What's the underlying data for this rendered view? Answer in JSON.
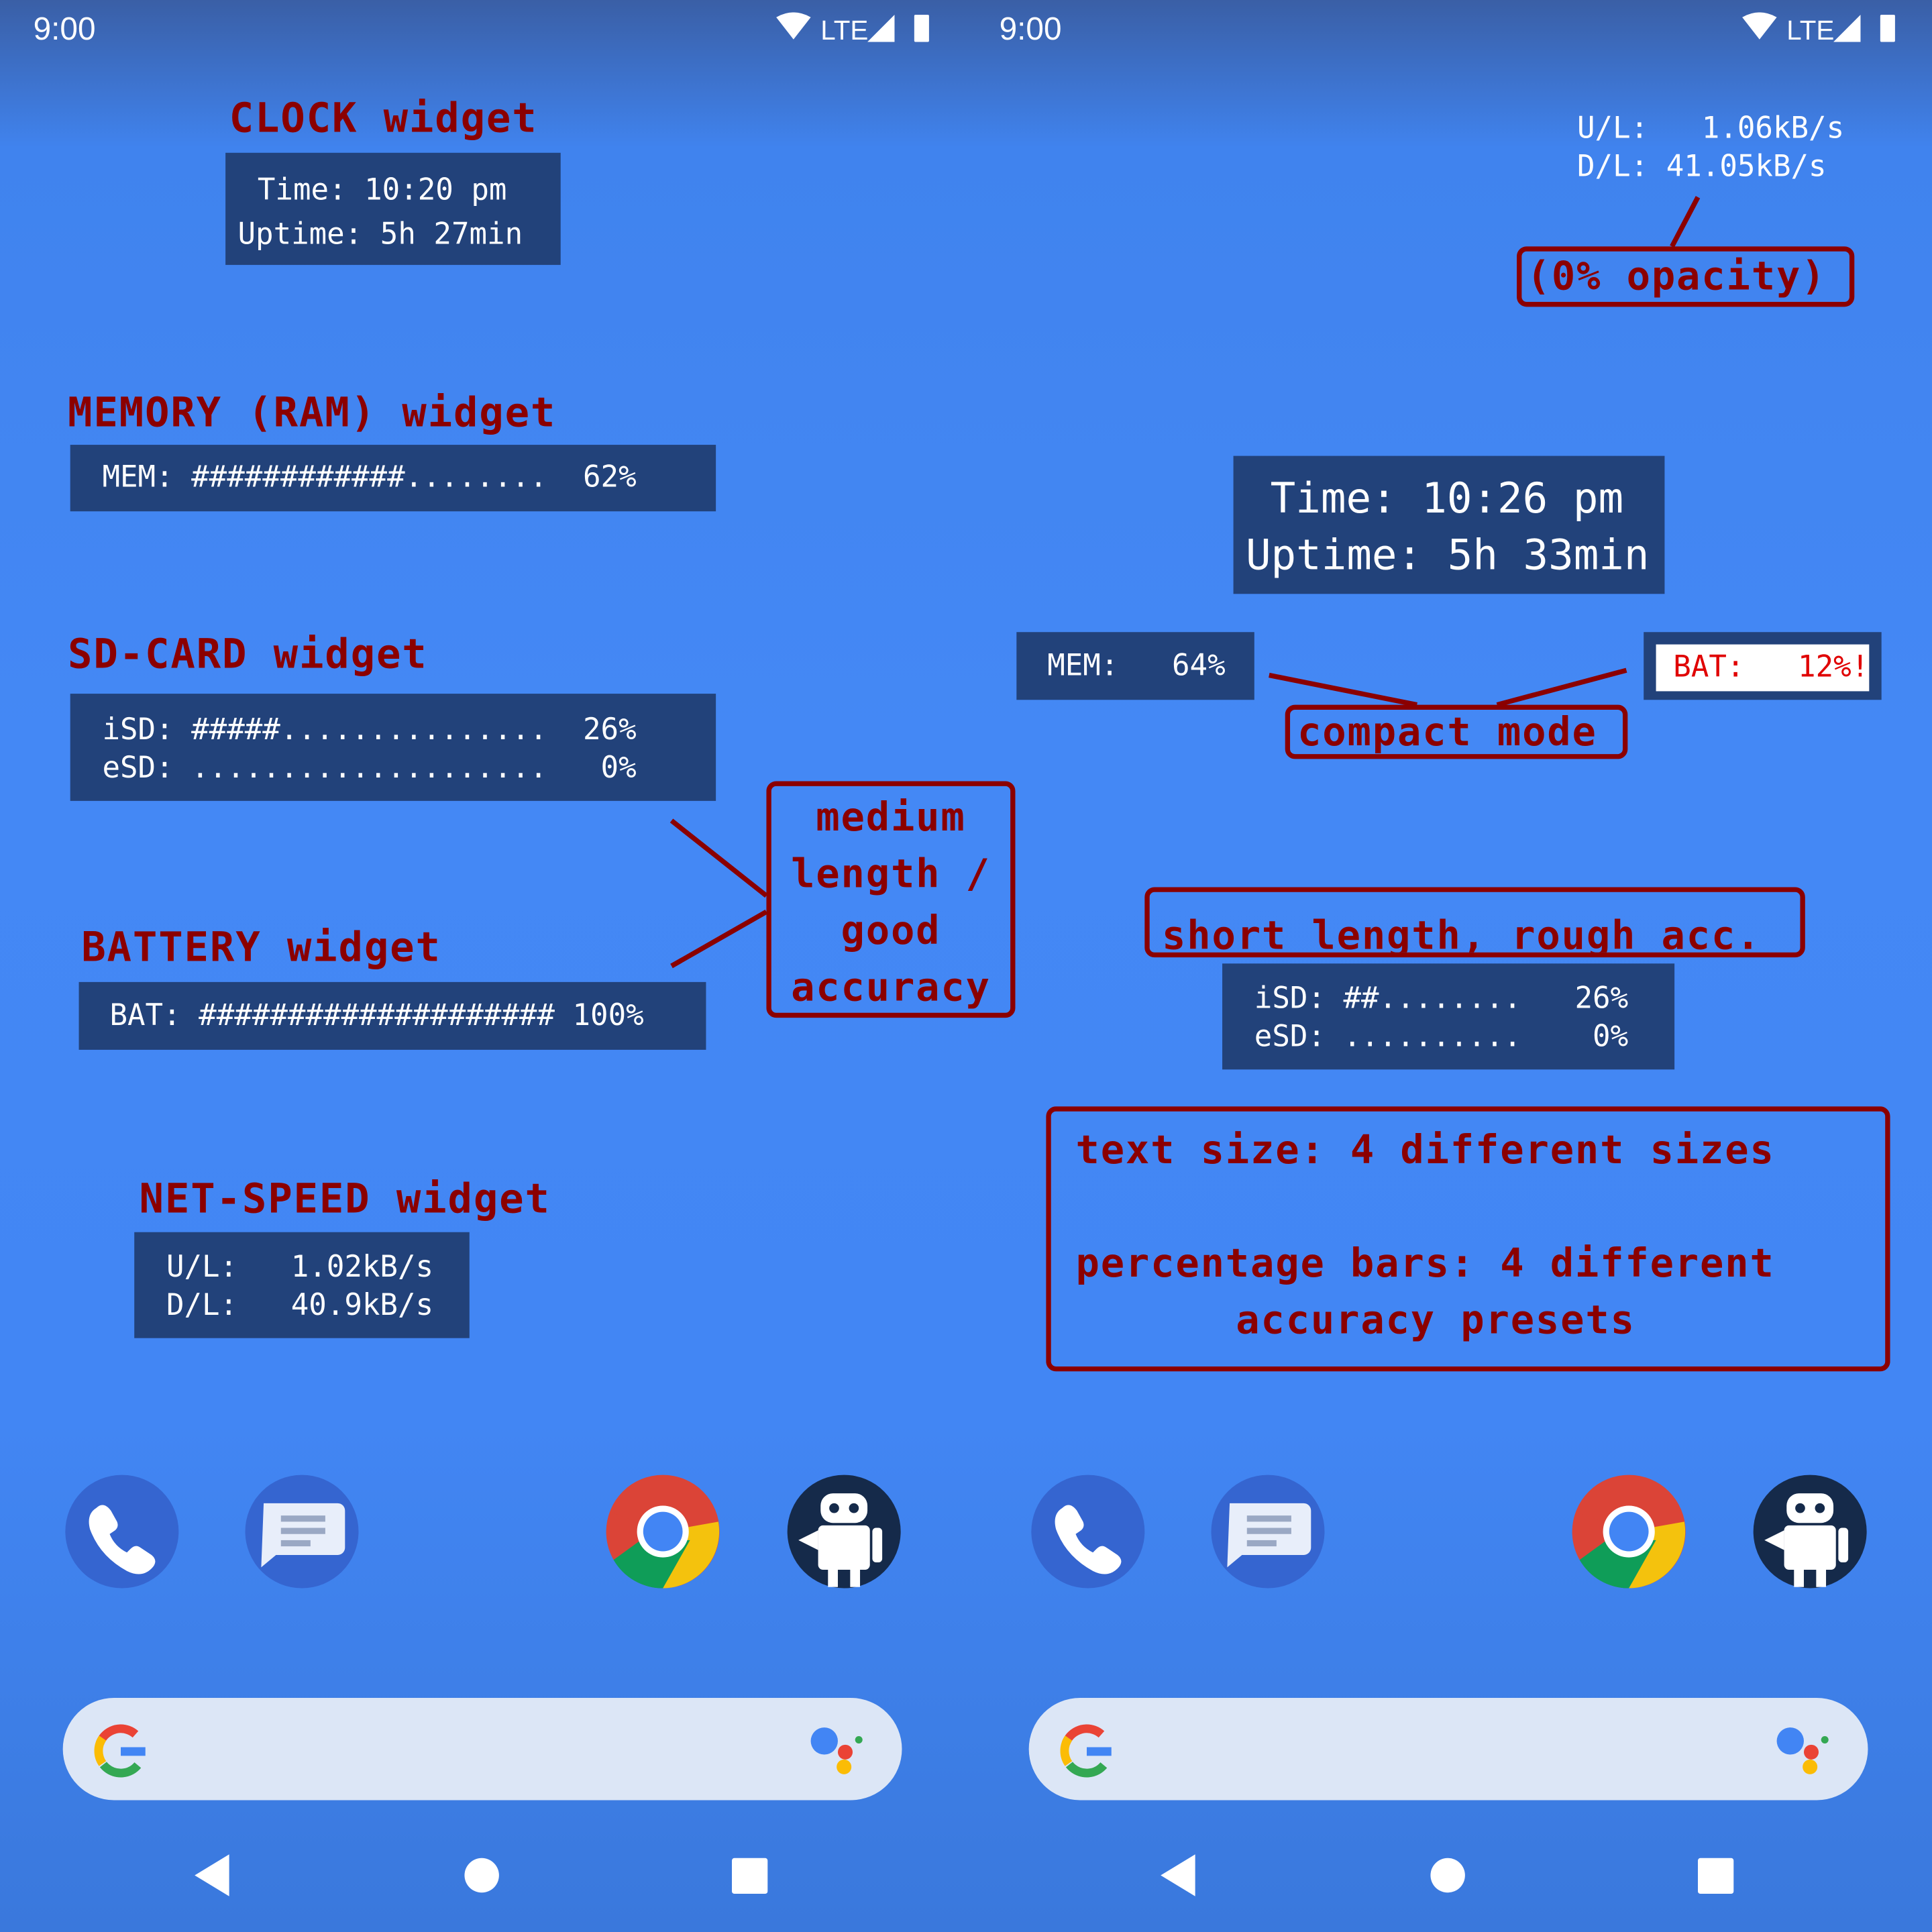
{
  "status_bar": {
    "time": "9:00",
    "network": "LTE",
    "icons": [
      "wifi-icon",
      "signal-icon",
      "battery-icon"
    ]
  },
  "left": {
    "clock": {
      "title": "CLOCK widget",
      "line1": "Time: 10:20 pm",
      "line2": "Uptime: 5h 27min"
    },
    "memory": {
      "title": "MEMORY (RAM) widget",
      "line": "MEM: ############........  62%"
    },
    "sdcard": {
      "title": "SD-CARD widget",
      "line1": "iSD: #####...............  26%",
      "line2": "eSD: ....................   0%"
    },
    "battery": {
      "title": "BATTERY widget",
      "line": "BAT: #################### 100%"
    },
    "netspeed": {
      "title": "NET-SPEED widget",
      "line1": "U/L:   1.02kB/s",
      "line2": "D/L:   40.9kB/s"
    },
    "note": {
      "line1": "medium",
      "line2": "length /",
      "line3": "good",
      "line4": "accuracy"
    }
  },
  "right": {
    "netspeed": {
      "line1": "U/L:   1.06kB/s",
      "line2": "D/L: 41.05kB/s"
    },
    "opacity_note": "(0% opacity)",
    "clock": {
      "line1": "Time: 10:26 pm",
      "line2": "Uptime: 5h 33min"
    },
    "memory": "MEM:   64%",
    "battery": "BAT:   12%!",
    "compact_note": "compact mode",
    "short_note": "short length, rough acc.",
    "sdcard": {
      "line1": "iSD: ##........   26%",
      "line2": "eSD: ..........    0%"
    },
    "info": {
      "line1": "text size: 4 different sizes",
      "line2": "percentage bars: 4 different",
      "line3": "accuracy presets"
    }
  },
  "dock": [
    "Phone",
    "Messages",
    "Chrome",
    "App"
  ],
  "colors": {
    "annotation": "#8b0000",
    "widget_bg": "#22427a",
    "wallpaper": "#4286f4",
    "warning": "#e00000"
  }
}
